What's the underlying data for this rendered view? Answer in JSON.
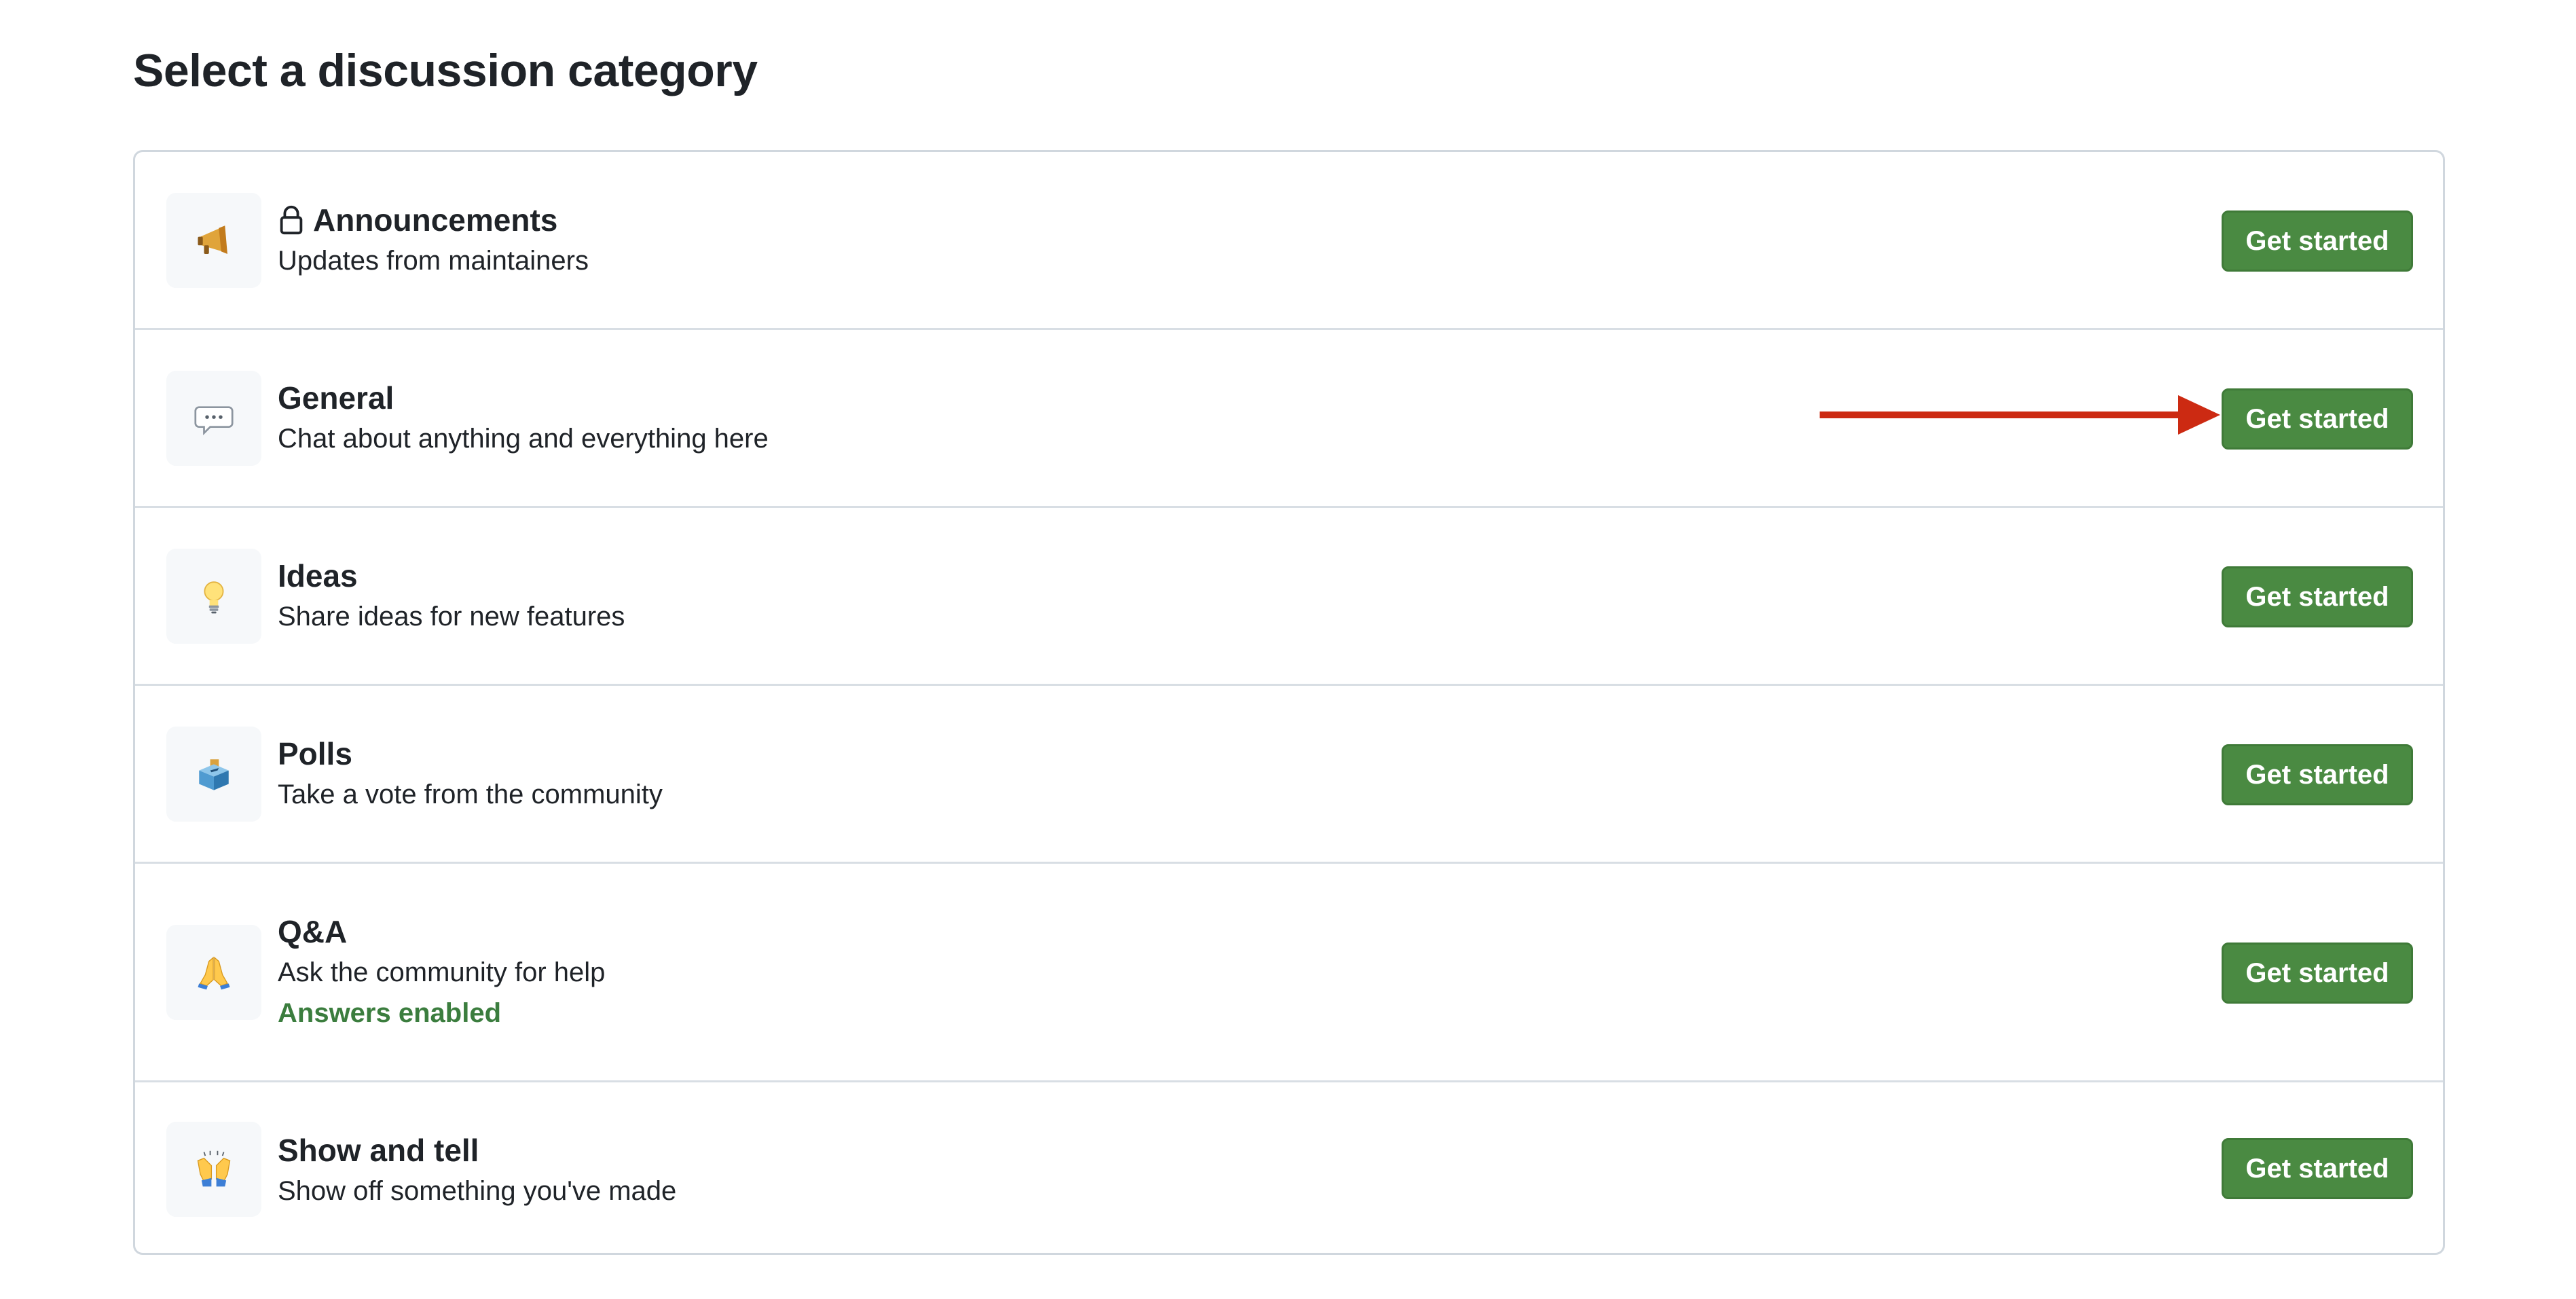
{
  "page_title": "Select a discussion category",
  "categories": [
    {
      "emoji_icon": "megaphone-icon",
      "locked": true,
      "title": "Announcements",
      "description": "Updates from maintainers",
      "note": "",
      "button_label": "Get started"
    },
    {
      "emoji_icon": "speech-balloon-icon",
      "locked": false,
      "title": "General",
      "description": "Chat about anything and everything here",
      "note": "",
      "button_label": "Get started"
    },
    {
      "emoji_icon": "light-bulb-icon",
      "locked": false,
      "title": "Ideas",
      "description": "Share ideas for new features",
      "note": "",
      "button_label": "Get started"
    },
    {
      "emoji_icon": "ballot-box-icon",
      "locked": false,
      "title": "Polls",
      "description": "Take a vote from the community",
      "note": "",
      "button_label": "Get started"
    },
    {
      "emoji_icon": "folded-hands-icon",
      "locked": false,
      "title": "Q&A",
      "description": "Ask the community for help",
      "note": "Answers enabled",
      "button_label": "Get started"
    },
    {
      "emoji_icon": "raising-hands-icon",
      "locked": false,
      "title": "Show and tell",
      "description": "Show off something you've made",
      "note": "",
      "button_label": "Get started"
    }
  ],
  "colors": {
    "button_green": "#4a8a42",
    "answers_enabled_green": "#3b7d3e",
    "annotation_arrow_red": "#cc2a12"
  }
}
